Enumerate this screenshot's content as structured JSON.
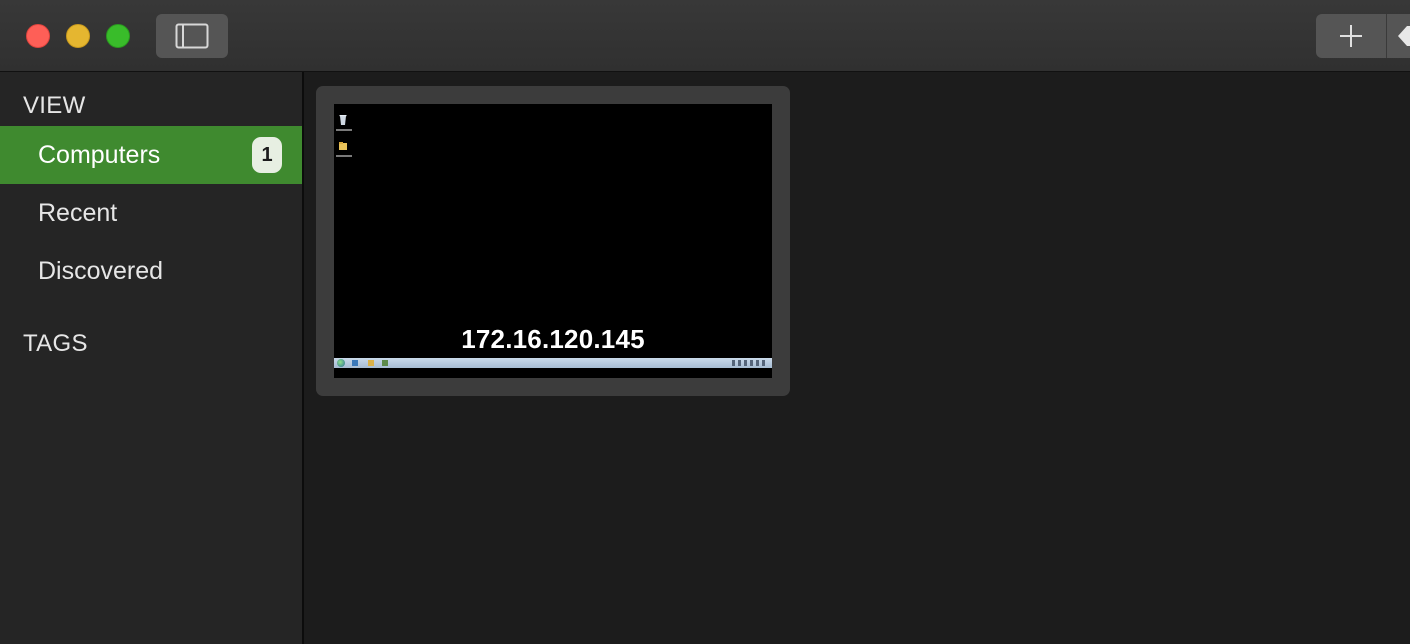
{
  "window": {
    "controls": {
      "close_color": "#fe5f57",
      "minimize_color": "#e5b630",
      "zoom_color": "#39bc2a"
    },
    "toolbar": {
      "sidebar_toggle_icon": "sidebar-icon",
      "add_icon": "plus-icon",
      "tag_icon": "tag-icon"
    }
  },
  "sidebar": {
    "view_header": "VIEW",
    "items": [
      {
        "label": "Computers",
        "badge": "1",
        "selected": true
      },
      {
        "label": "Recent",
        "selected": false
      },
      {
        "label": "Discovered",
        "selected": false
      }
    ],
    "tags_header": "TAGS",
    "accent_color": "#3f8a2f"
  },
  "main": {
    "computers": [
      {
        "address": "172.16.120.145"
      }
    ]
  }
}
